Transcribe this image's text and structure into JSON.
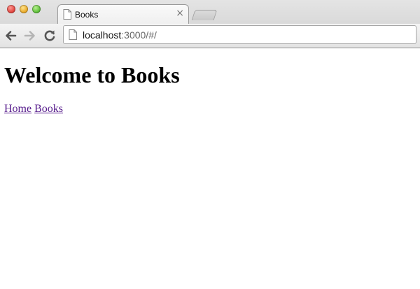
{
  "browser": {
    "tab": {
      "title": "Books",
      "close_icon": "close-icon",
      "page_icon": "page-icon"
    },
    "new_tab_icon": "new-tab-icon",
    "toolbar": {
      "back_icon": "back-arrow-icon",
      "forward_icon": "forward-arrow-icon",
      "reload_icon": "reload-icon"
    },
    "address_bar": {
      "host": "localhost",
      "rest": ":3000/#/"
    }
  },
  "page": {
    "heading": "Welcome to Books",
    "nav_links": [
      {
        "label": "Home"
      },
      {
        "label": "Books"
      }
    ]
  },
  "colors": {
    "visited_link": "#551a8b",
    "window_close": "#e0443e",
    "window_minimize": "#e8a92a",
    "window_zoom": "#5fbf3a"
  }
}
